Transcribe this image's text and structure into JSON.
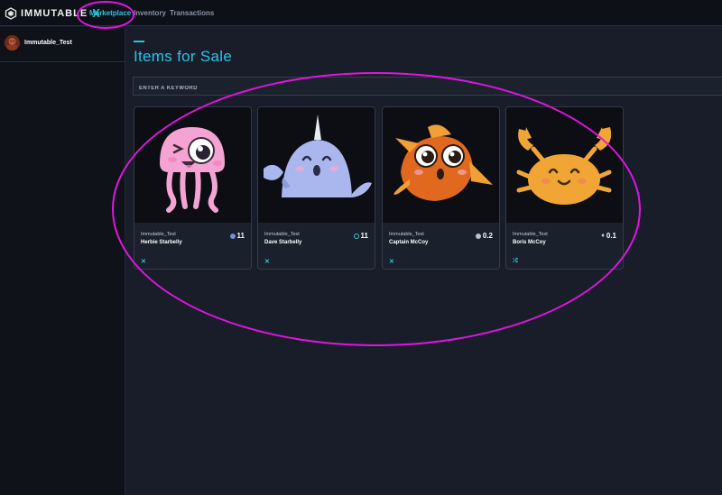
{
  "app": {
    "logo_text": "IMMUTABLE",
    "logo_x": "X"
  },
  "nav": {
    "marketplace": "Marketplace",
    "inventory": "Inventory",
    "transactions": "Transactions"
  },
  "sidebar": {
    "user_name": "Immutable_Test"
  },
  "main": {
    "title": "Items for Sale",
    "search_placeholder": "ENTER A KEYWORD"
  },
  "cards": [
    {
      "owner": "Immutable_Test",
      "name": "Herbie Starbelly",
      "price": "11",
      "currency_icon": "imx-coin-icon",
      "foot_icon": "x-icon"
    },
    {
      "owner": "Immutable_Test",
      "name": "Dave Starbelly",
      "price": "11",
      "currency_icon": "ring-coin-icon",
      "foot_icon": "x-icon"
    },
    {
      "owner": "Immutable_Test",
      "name": "Captain McCoy",
      "price": "0.2",
      "currency_icon": "gear-coin-icon",
      "foot_icon": "x-icon"
    },
    {
      "owner": "Immutable_Test",
      "name": "Boris McCoy",
      "price": "0.1",
      "currency_icon": "eth-icon",
      "foot_icon": "transfer-icon"
    }
  ],
  "colors": {
    "accent": "#26c6e6",
    "annotation": "#e015e0",
    "background": "#181d29"
  }
}
